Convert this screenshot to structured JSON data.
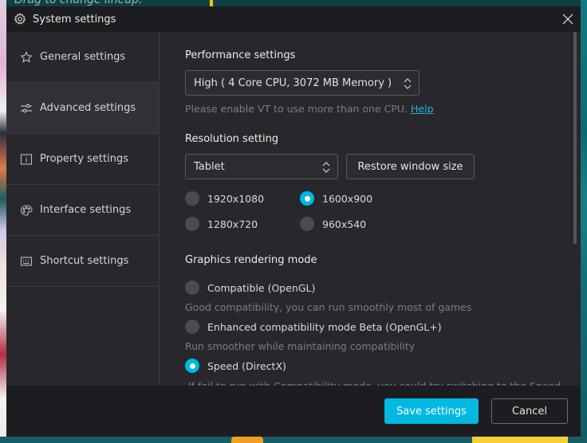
{
  "background": {
    "top_text": "Drag to change lineup."
  },
  "dialog": {
    "title": "System settings",
    "icons": {
      "title": "gear-icon",
      "close": "close-icon"
    }
  },
  "sidebar": {
    "items": [
      {
        "label": "General settings",
        "icon": "star-icon",
        "active": false
      },
      {
        "label": "Advanced settings",
        "icon": "sliders-icon",
        "active": true
      },
      {
        "label": "Property settings",
        "icon": "info-icon",
        "active": false
      },
      {
        "label": "Interface settings",
        "icon": "palette-icon",
        "active": false
      },
      {
        "label": "Shortcut settings",
        "icon": "keyboard-icon",
        "active": false
      }
    ]
  },
  "performance": {
    "title": "Performance settings",
    "selected": "High ( 4 Core CPU, 3072 MB Memory )",
    "hint": "Please enable VT to use more than one CPU.",
    "help_link": "Help"
  },
  "resolution": {
    "title": "Resolution setting",
    "selected": "Tablet",
    "restore_button": "Restore window size",
    "options": [
      {
        "label": "1920x1080",
        "checked": false
      },
      {
        "label": "1600x900",
        "checked": true
      },
      {
        "label": "1280x720",
        "checked": false
      },
      {
        "label": "960x540",
        "checked": false
      }
    ]
  },
  "graphics": {
    "title": "Graphics rendering mode",
    "options": [
      {
        "label": "Compatible (OpenGL)",
        "description": "Good compatibility, you can run smoothly most of games",
        "checked": false
      },
      {
        "label": "Enhanced compatibility mode Beta (OpenGL+)",
        "description": "Run smoother while maintaining compatibility",
        "checked": false
      },
      {
        "label": "Speed (DirectX)",
        "description": "If fail to run with Compatibility mode, you could try switching to the Speed",
        "checked": true
      }
    ]
  },
  "footer": {
    "save_label": "Save settings",
    "cancel_label": "Cancel"
  },
  "colors": {
    "accent": "#00b8e0",
    "dialog_bg": "#27272c",
    "titlebar_bg": "#1d1d21",
    "link": "#1fb3e0"
  }
}
